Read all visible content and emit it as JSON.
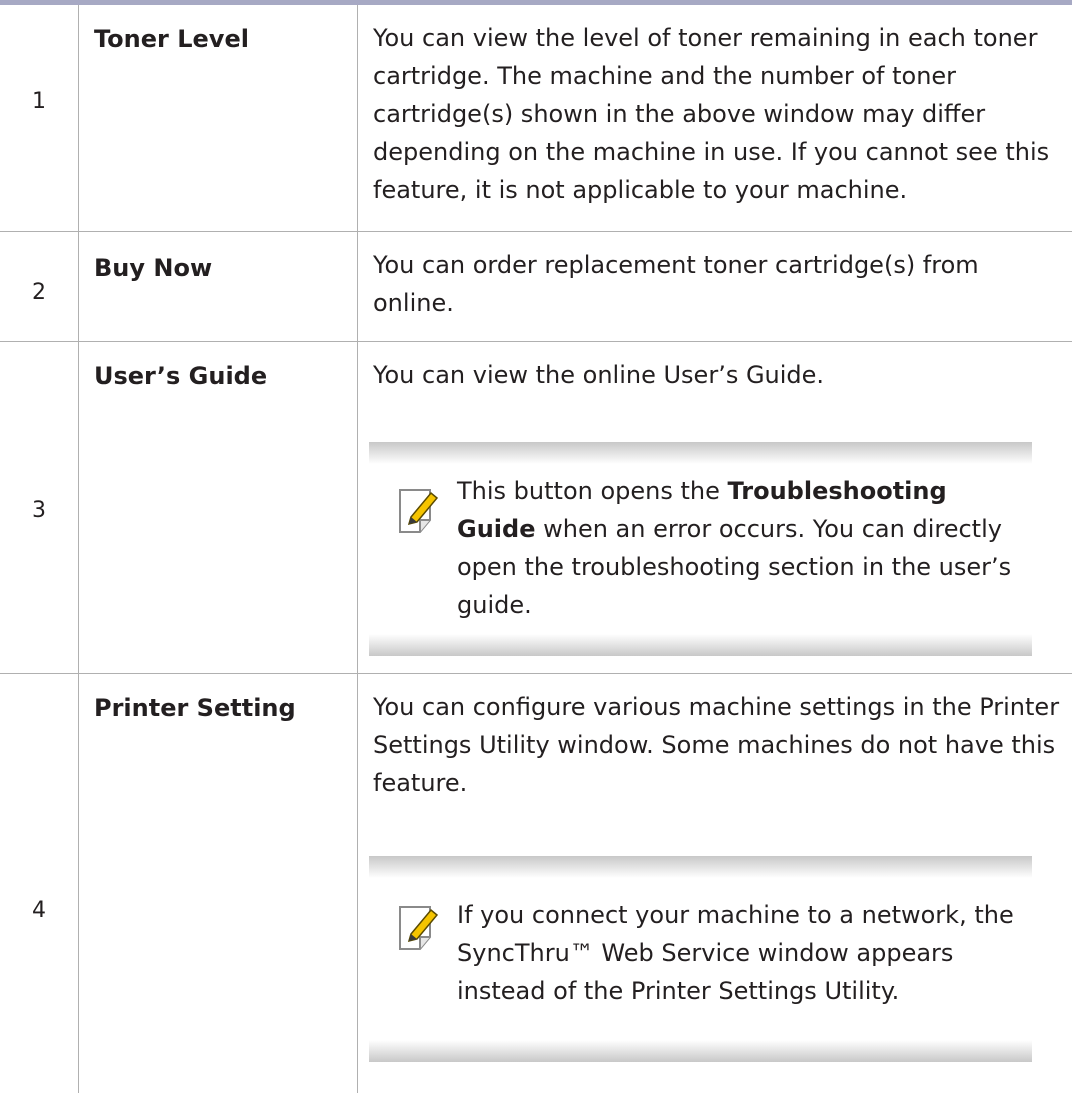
{
  "rows": [
    {
      "number": "1",
      "name": "Toner Level",
      "description": "You can view the level of toner remaining in each toner cartridge. The machine and the number of toner cartridge(s) shown in the above window may differ depending on the machine in use. If you cannot see this feature, it is not applicable to your machine."
    },
    {
      "number": "2",
      "name": "Buy Now",
      "description": "You can order replacement toner cartridge(s) from online."
    },
    {
      "number": "3",
      "name": "User’s Guide",
      "description": "You can view the online User’s Guide.",
      "note": {
        "icon": "note-pencil-icon",
        "text_before": "This button opens the ",
        "text_bold": "Troubleshooting Guide",
        "text_after": " when an error occurs. You can directly open the troubleshooting section in the user’s guide."
      }
    },
    {
      "number": "4",
      "name": "Printer Setting",
      "description": "You can configure various machine settings in the Printer Settings Utility window. Some machines do not have this feature.",
      "note": {
        "icon": "note-pencil-icon",
        "text": "If you connect your machine to a network, the SyncThru™ Web Service window appears instead of the Printer Settings Utility."
      }
    }
  ],
  "colors": {
    "top_rule": "#a7a9c4",
    "grid_line": "#b0b0b0",
    "text": "#231f20",
    "note_shade": "#c8c8c8",
    "icon_accent": "#f5c400"
  }
}
